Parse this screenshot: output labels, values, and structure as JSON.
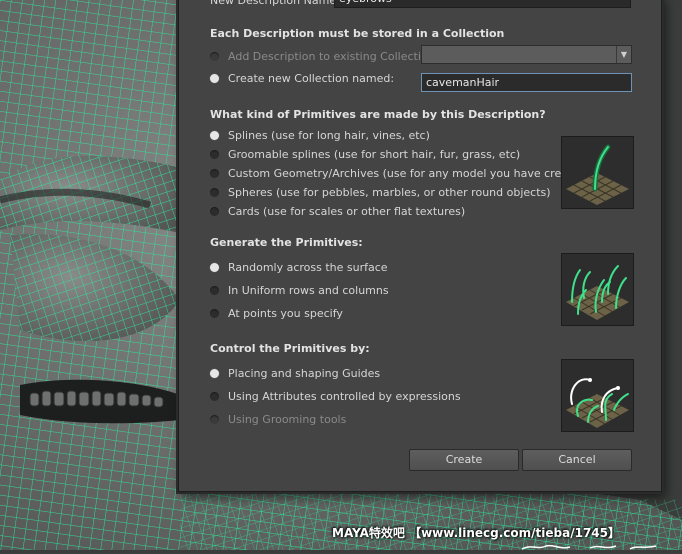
{
  "top_field": {
    "label": "New Description Name:",
    "value": "eyebrows"
  },
  "collection": {
    "heading": "Each Description must be stored in a Collection",
    "add_existing": {
      "label": "Add Description to existing Collection:",
      "value": ""
    },
    "create_new": {
      "label": "Create new Collection named:",
      "value": "cavemanHair"
    }
  },
  "primitives": {
    "heading": "What kind of Primitives are made by this Description?",
    "options": [
      "Splines (use for long hair, vines, etc)",
      "Groomable splines (use for short hair, fur, grass, etc)",
      "Custom Geometry/Archives (use for any model you have created)",
      "Spheres (use for pebbles, marbles, or other round objects)",
      "Cards (use for scales or other flat textures)"
    ]
  },
  "generate": {
    "heading": "Generate the Primitives:",
    "options": [
      "Randomly across the surface",
      "In Uniform rows and columns",
      "At points you specify"
    ]
  },
  "control": {
    "heading": "Control the Primitives by:",
    "options": [
      "Placing and shaping Guides",
      "Using Attributes controlled by expressions",
      "Using Grooming tools"
    ]
  },
  "buttons": {
    "create": "Create",
    "cancel": "Cancel"
  },
  "watermark": "MAYA特效吧 【www.linecg.com/tieba/1745】",
  "colors": {
    "wire": "#2ee89a",
    "dialog_bg": "#444444",
    "active_border": "#6f93b5"
  },
  "icons": {
    "primitive_preview": "single-curved-spline-on-grid",
    "generate_preview": "random-splines-on-grid",
    "control_preview": "guides-on-grid"
  }
}
